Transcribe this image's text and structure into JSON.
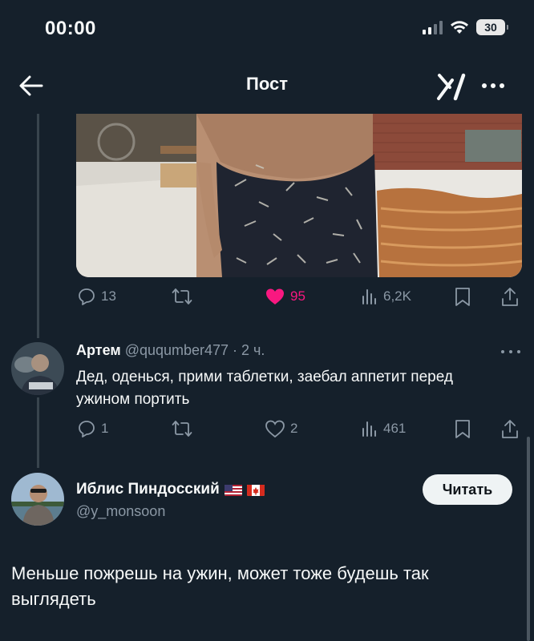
{
  "status_bar": {
    "time": "00:00",
    "battery": "30"
  },
  "nav": {
    "title": "Пост"
  },
  "tweet_actions": {
    "replies": "13",
    "likes": "95",
    "views": "6,2K"
  },
  "reply": {
    "name": "Артем",
    "meta": "@ququmber477 · 2 ч.",
    "text": "Дед, оденься, прими таблетки, заебал аппетит перед ужином портить",
    "replies": "1",
    "likes": "2",
    "views": "461"
  },
  "main_post": {
    "name": "Иблис Пиндосский",
    "handle": "@y_monsoon",
    "follow_label": "Читать",
    "text": "Меньше пожрешь на ужин, может тоже будешь так выглядеть"
  },
  "colors": {
    "background": "#15202b",
    "like_pink": "#f91880",
    "muted": "#8b98a5"
  }
}
